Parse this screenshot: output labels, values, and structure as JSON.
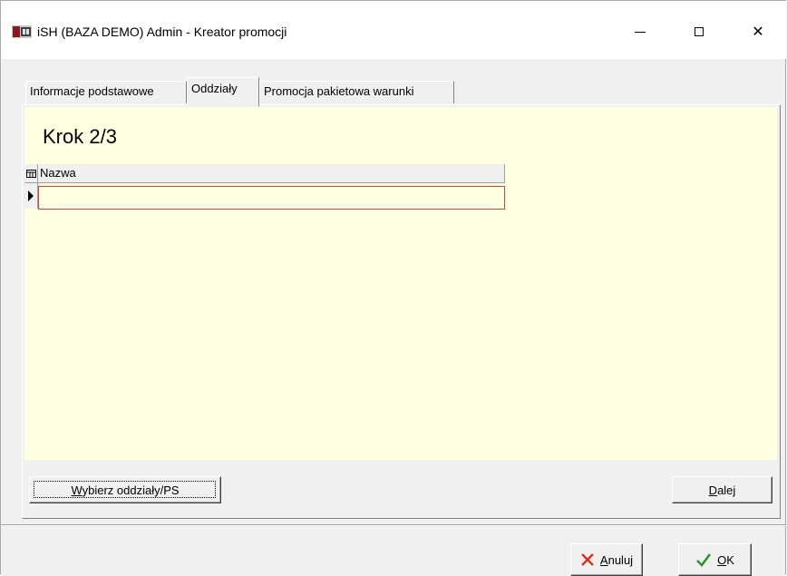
{
  "window": {
    "title": "iSH (BAZA DEMO) Admin - Kreator promocji",
    "minimize_glyph": "",
    "maximize_glyph": "",
    "close_glyph": "✕"
  },
  "tabs": [
    {
      "label": "Informacje podstawowe",
      "active": false
    },
    {
      "label": "Oddziały",
      "active": true
    },
    {
      "label": "Promocja pakietowa warunki",
      "active": false
    }
  ],
  "page": {
    "step_title": "Krok 2/3",
    "background_color": "#ffffe1"
  },
  "grid": {
    "columns": [
      "Nazwa"
    ],
    "rows": [
      {
        "nazwa": ""
      }
    ]
  },
  "buttons": {
    "wybierz": {
      "accel": "W",
      "rest": "ybierz oddziały/PS"
    },
    "dalej": {
      "accel": "D",
      "rest": "alej"
    },
    "anuluj": {
      "accel": "A",
      "rest": "nuluj"
    },
    "ok": {
      "accel": "O",
      "rest": "K"
    }
  },
  "icons": {
    "anuluj": "x-icon",
    "ok": "check-icon",
    "grid_corner": "grid-icon",
    "row": "row-pointer-icon"
  }
}
